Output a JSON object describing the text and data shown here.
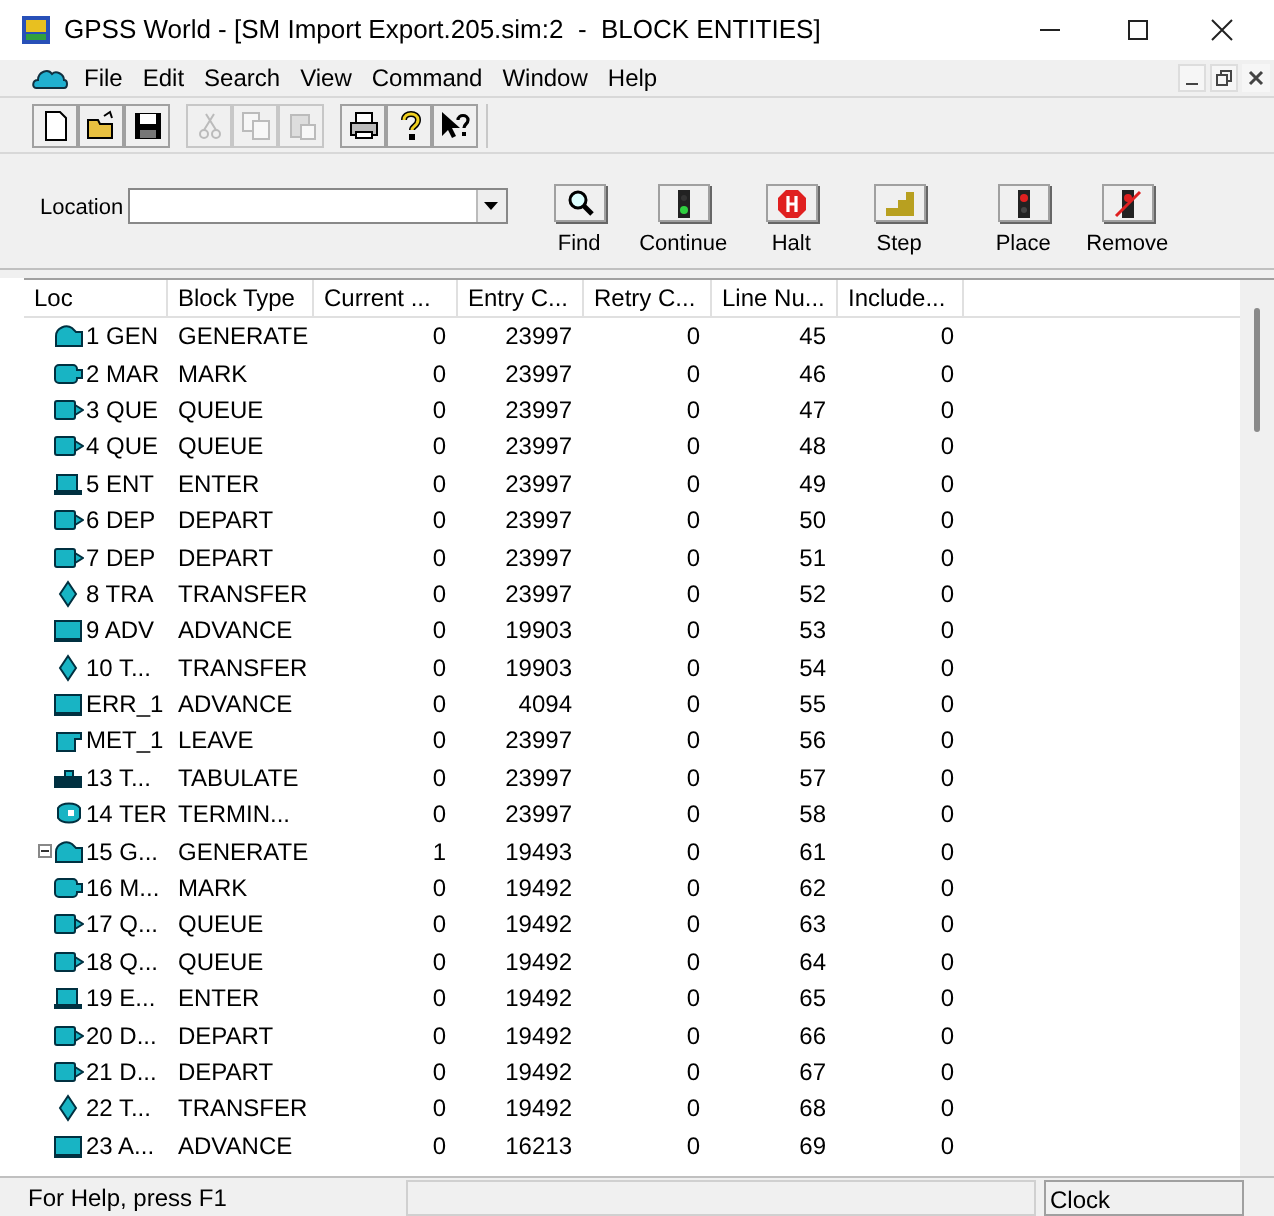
{
  "window": {
    "title": "GPSS World - [SM Import Export.205.sim:2  -  BLOCK ENTITIES]"
  },
  "menu": [
    "File",
    "Edit",
    "Search",
    "View",
    "Command",
    "Window",
    "Help"
  ],
  "toolbar": [
    {
      "kind": "new",
      "disabled": false
    },
    {
      "kind": "open",
      "disabled": false
    },
    {
      "kind": "save",
      "disabled": false
    },
    {
      "kind": "cut",
      "disabled": true
    },
    {
      "kind": "copy",
      "disabled": true
    },
    {
      "kind": "paste",
      "disabled": true
    },
    {
      "kind": "print",
      "disabled": false
    },
    {
      "kind": "help",
      "disabled": false
    },
    {
      "kind": "context-help",
      "disabled": false
    }
  ],
  "location": {
    "label": "Location"
  },
  "commands": [
    {
      "kind": "find",
      "label": "Find"
    },
    {
      "kind": "continue",
      "label": "Continue"
    },
    {
      "kind": "halt",
      "label": "Halt"
    },
    {
      "kind": "step",
      "label": "Step"
    },
    {
      "kind": "place",
      "label": "Place"
    },
    {
      "kind": "remove",
      "label": "Remove"
    }
  ],
  "table": {
    "columns": [
      "Loc",
      "Block Type",
      "Current ...",
      "Entry C...",
      "Retry C...",
      "Line Nu...",
      "Include..."
    ],
    "rows": [
      {
        "kind": "generate",
        "cells": [
          "1 GEN",
          "GENERATE",
          "0",
          "23997",
          "0",
          "45",
          "0"
        ]
      },
      {
        "kind": "mark",
        "cells": [
          "2 MAR",
          "MARK",
          "0",
          "23997",
          "0",
          "46",
          "0"
        ]
      },
      {
        "kind": "queue",
        "cells": [
          "3 QUE",
          "QUEUE",
          "0",
          "23997",
          "0",
          "47",
          "0"
        ]
      },
      {
        "kind": "queue",
        "cells": [
          "4 QUE",
          "QUEUE",
          "0",
          "23997",
          "0",
          "48",
          "0"
        ]
      },
      {
        "kind": "enter",
        "cells": [
          "5 ENT",
          "ENTER",
          "0",
          "23997",
          "0",
          "49",
          "0"
        ]
      },
      {
        "kind": "queue",
        "cells": [
          "6 DEP",
          "DEPART",
          "0",
          "23997",
          "0",
          "50",
          "0"
        ]
      },
      {
        "kind": "queue",
        "cells": [
          "7 DEP",
          "DEPART",
          "0",
          "23997",
          "0",
          "51",
          "0"
        ]
      },
      {
        "kind": "transfer",
        "cells": [
          "8 TRA",
          "TRANSFER",
          "0",
          "23997",
          "0",
          "52",
          "0"
        ]
      },
      {
        "kind": "advance",
        "cells": [
          "9 ADV",
          "ADVANCE",
          "0",
          "19903",
          "0",
          "53",
          "0"
        ]
      },
      {
        "kind": "transfer",
        "cells": [
          "10 T...",
          "TRANSFER",
          "0",
          "19903",
          "0",
          "54",
          "0"
        ]
      },
      {
        "kind": "advance",
        "cells": [
          "ERR_1",
          "ADVANCE",
          "0",
          "4094",
          "0",
          "55",
          "0"
        ]
      },
      {
        "kind": "leave",
        "cells": [
          "MET_1",
          "LEAVE",
          "0",
          "23997",
          "0",
          "56",
          "0"
        ]
      },
      {
        "kind": "tabulate",
        "cells": [
          "13 T...",
          "TABULATE",
          "0",
          "23997",
          "0",
          "57",
          "0"
        ]
      },
      {
        "kind": "terminate",
        "cells": [
          "14 TER",
          "TERMIN...",
          "0",
          "23997",
          "0",
          "58",
          "0"
        ]
      },
      {
        "kind": "generate",
        "expanded": true,
        "cells": [
          "15 G...",
          "GENERATE",
          "1",
          "19493",
          "0",
          "61",
          "0"
        ]
      },
      {
        "kind": "mark",
        "cells": [
          "16 M...",
          "MARK",
          "0",
          "19492",
          "0",
          "62",
          "0"
        ]
      },
      {
        "kind": "queue",
        "cells": [
          "17 Q...",
          "QUEUE",
          "0",
          "19492",
          "0",
          "63",
          "0"
        ]
      },
      {
        "kind": "queue",
        "cells": [
          "18 Q...",
          "QUEUE",
          "0",
          "19492",
          "0",
          "64",
          "0"
        ]
      },
      {
        "kind": "enter",
        "cells": [
          "19 E...",
          "ENTER",
          "0",
          "19492",
          "0",
          "65",
          "0"
        ]
      },
      {
        "kind": "queue",
        "cells": [
          "20 D...",
          "DEPART",
          "0",
          "19492",
          "0",
          "66",
          "0"
        ]
      },
      {
        "kind": "queue",
        "cells": [
          "21 D...",
          "DEPART",
          "0",
          "19492",
          "0",
          "67",
          "0"
        ]
      },
      {
        "kind": "transfer",
        "cells": [
          "22 T...",
          "TRANSFER",
          "0",
          "19492",
          "0",
          "68",
          "0"
        ]
      },
      {
        "kind": "advance",
        "cells": [
          "23 A...",
          "ADVANCE",
          "0",
          "16213",
          "0",
          "69",
          "0"
        ]
      }
    ]
  },
  "status_bar": {
    "help": "For Help, press F1",
    "clock": "Clock"
  }
}
